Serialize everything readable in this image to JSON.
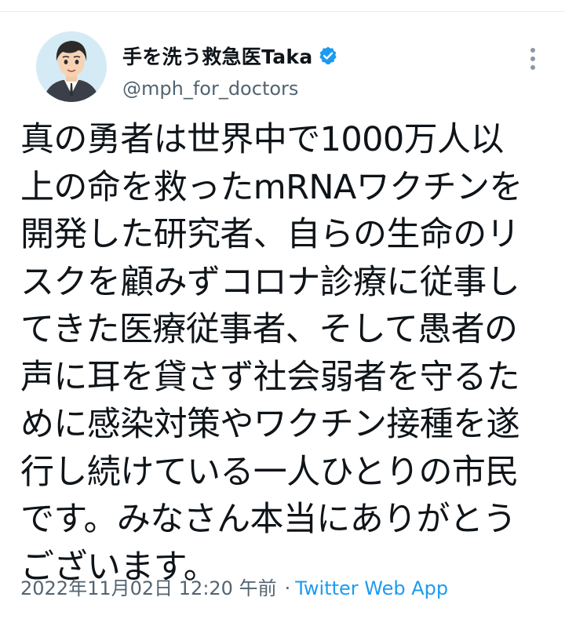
{
  "tweet": {
    "author": {
      "display_name": "手を洗う救急医Taka",
      "handle": "@mph_for_doctors",
      "verified": true,
      "verified_color": "#1d9bf0"
    },
    "text_lines": [
      "真の勇者は世界中で1000万人以",
      "上の命を救ったmRNAワクチンを",
      "開発した研究者、自らの生命のリ",
      "スクを顧みずコロナ診療に従事し",
      "てきた医療従事者、そして愚者の",
      "声に耳を貸さず社会弱者を守るた",
      "めに感染対策やワクチン接種を遂",
      "行し続けている一人ひとりの市民",
      "です。みなさん本当にありがとう",
      "ございます。"
    ],
    "timestamp": "2022年11月02日 12:20 午前",
    "separator": "·",
    "source": "Twitter Web App"
  },
  "icons": {
    "avatar": "avatar-illustration",
    "verified": "verified-badge-icon",
    "more": "more-vertical-icon"
  },
  "colors": {
    "text_primary": "#0f1419",
    "text_secondary": "#536471",
    "link": "#1d9bf0"
  }
}
